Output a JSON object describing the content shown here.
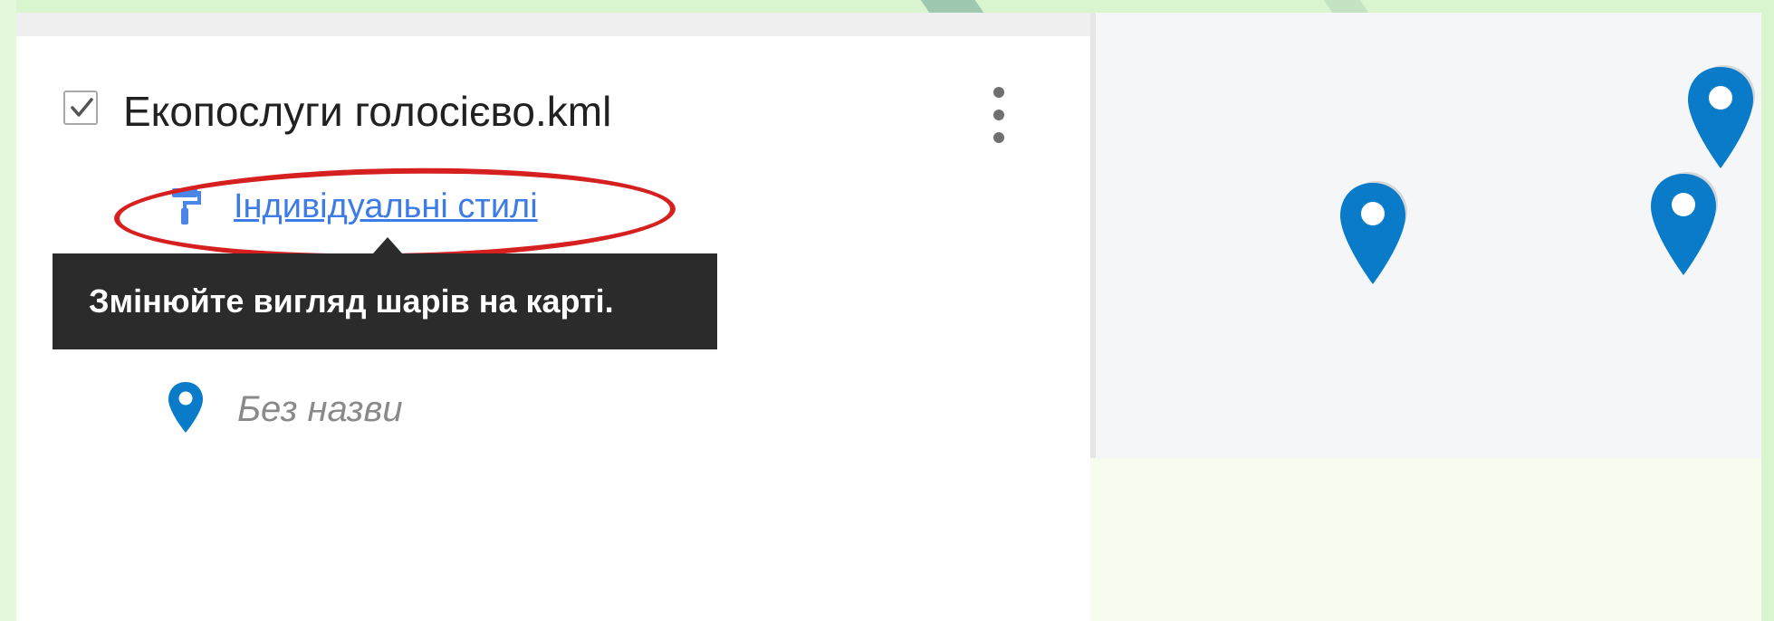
{
  "layer": {
    "checked": true,
    "title": "Екопослуги голосієво.kml",
    "menu_icon": "more-vertical-icon"
  },
  "style_link": {
    "icon": "paint-roller-icon",
    "label": "Індивідуальні стилі"
  },
  "tooltip": {
    "text": "Змінюйте вигляд шарів на карті."
  },
  "features": [
    {
      "icon": "map-pin-icon",
      "label": "Без назви"
    }
  ],
  "map": {
    "marker_icon": "map-pin-icon",
    "marker_count": 3
  },
  "colors": {
    "marker": "#0a7bc9",
    "link": "#3d7ce6",
    "highlight": "#d62020",
    "tooltip_bg": "#2b2b2b"
  }
}
